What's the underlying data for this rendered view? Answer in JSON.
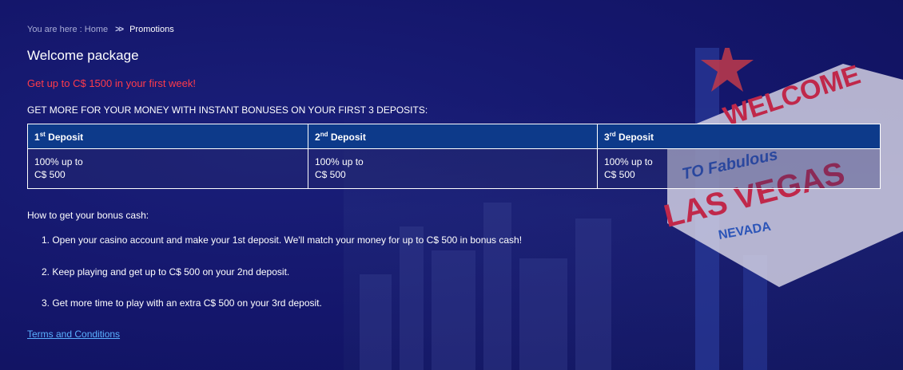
{
  "breadcrumb": {
    "prefix": "You are here :",
    "home": "Home",
    "separator": ">>",
    "current": "Promotions"
  },
  "page_title": "Welcome package",
  "offer_text": "Get up to C$ 1500 in your first week!",
  "subheading": "GET MORE FOR YOUR MONEY WITH INSTANT BONUSES ON YOUR FIRST 3 DEPOSITS:",
  "deposits": [
    {
      "num": "1",
      "suffix": "st",
      "label": "Deposit",
      "line1": "100% up to",
      "line2": "C$ 500"
    },
    {
      "num": "2",
      "suffix": "nd",
      "label": "Deposit",
      "line1": "100% up to",
      "line2": "C$ 500"
    },
    {
      "num": "3",
      "suffix": "rd",
      "label": "Deposit",
      "line1": "100% up to",
      "line2": "C$ 500"
    }
  ],
  "howto_title": "How to get your bonus cash:",
  "steps": [
    "1. Open your casino account and make your 1st deposit. We'll match your money for up to C$ 500 in bonus cash!",
    "2. Keep playing and get up to C$ 500 on your 2nd deposit.",
    "3. Get more time to play with an extra C$ 500 on your 3rd deposit."
  ],
  "terms_link": "Terms and Conditions",
  "background": {
    "sign_text_top": "WELCOME",
    "sign_text_mid": "TO Fabulous",
    "sign_text_main": "LAS VEGAS",
    "sign_text_bottom": "NEVADA"
  },
  "colors": {
    "background": "#14166b",
    "table_header": "#0d3a8a",
    "offer_red": "#ff3b4a",
    "link_blue": "#5ab0ff"
  }
}
